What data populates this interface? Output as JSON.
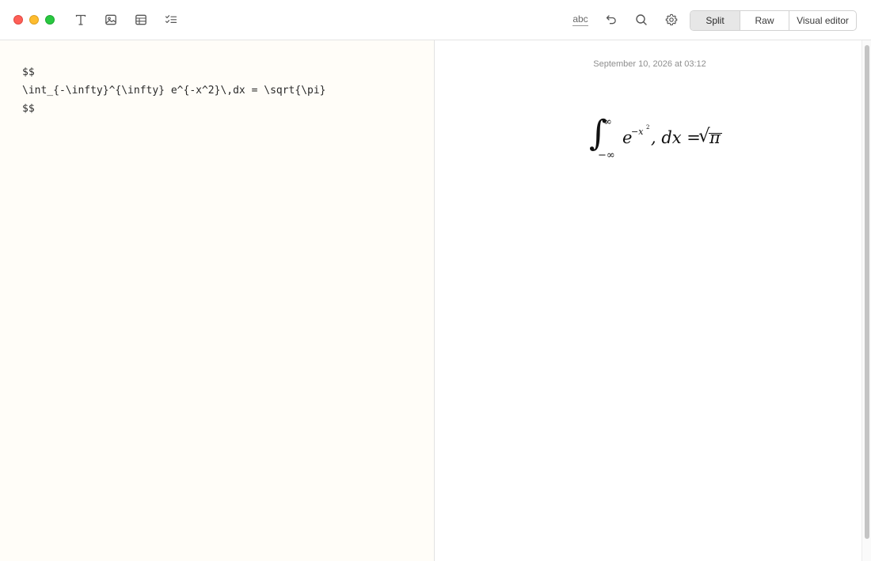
{
  "toolbar": {
    "window_controls": [
      "close",
      "minimize",
      "zoom"
    ],
    "insert_tools": [
      {
        "name": "text-format-icon"
      },
      {
        "name": "image-icon"
      },
      {
        "name": "table-icon"
      },
      {
        "name": "checklist-icon"
      }
    ],
    "spellcheck_label": "abc",
    "right_icons": [
      "undo-icon",
      "search-icon",
      "gear-icon"
    ],
    "view_modes": {
      "split": "Split",
      "raw": "Raw",
      "visual": "Visual editor",
      "selected": "Split"
    }
  },
  "editor": {
    "content": "$$\n\\int_{-\\infty}^{\\infty} e^{-x^2}\\,dx = \\sqrt{\\pi}\n$$"
  },
  "preview": {
    "timestamp": "September 10, 2026 at 03:12",
    "formula": {
      "integral": "∫",
      "upper_limit": "∞",
      "lower_limit": "−∞",
      "base": "e",
      "exponent": "−x",
      "exponent_power": "2",
      "middle": ", dx =",
      "radical": "√",
      "radicand": "π"
    }
  },
  "colors": {
    "editor_bg": "#fffdf8",
    "selected_segment": "#e7e7e7",
    "close": "#fe5f57",
    "minimize": "#febc2e",
    "zoom": "#28c840"
  }
}
